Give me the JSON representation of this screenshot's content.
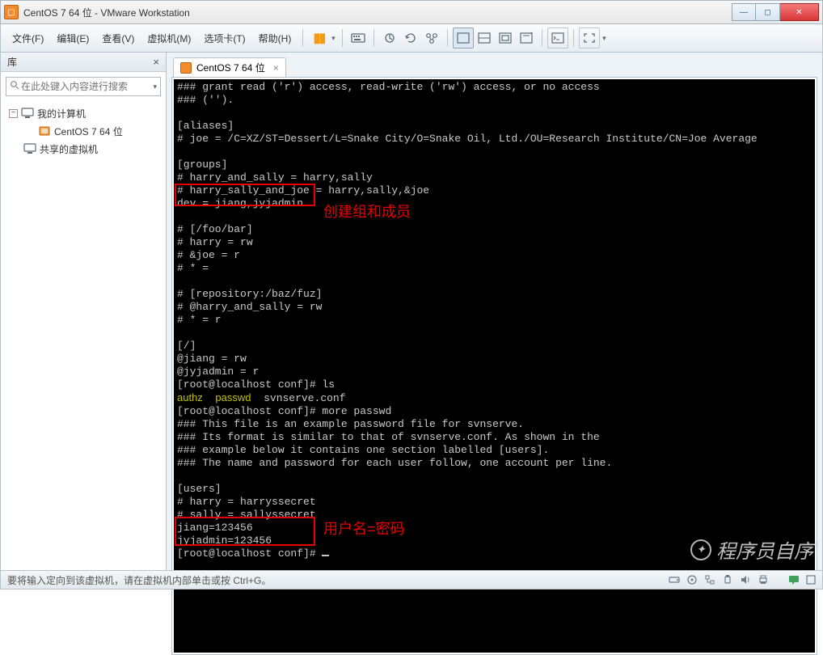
{
  "window": {
    "title": "CentOS 7 64 位 - VMware Workstation"
  },
  "menu": {
    "file": "文件(F)",
    "edit": "编辑(E)",
    "view": "查看(V)",
    "vm": "虚拟机(M)",
    "tabs": "选项卡(T)",
    "help": "帮助(H)"
  },
  "sidebar": {
    "title": "库",
    "placeholder": "在此处键入内容进行搜索",
    "root": "我的计算机",
    "vm_name": "CentOS 7 64 位",
    "shared": "共享的虚拟机"
  },
  "tab": {
    "label": "CentOS 7 64 位"
  },
  "terminal_lines": [
    "### grant read ('r') access, read-write ('rw') access, or no access",
    "### ('').",
    "",
    "[aliases]",
    "# joe = /C=XZ/ST=Dessert/L=Snake City/O=Snake Oil, Ltd./OU=Research Institute/CN=Joe Average",
    "",
    "[groups]",
    "# harry_and_sally = harry,sally",
    "# harry_sally_and_joe = harry,sally,&joe",
    "dev = jiang,jyjadmin",
    "",
    "# [/foo/bar]",
    "# harry = rw",
    "# &joe = r",
    "# * =",
    "",
    "# [repository:/baz/fuz]",
    "# @harry_and_sally = rw",
    "# * = r",
    "",
    "[/]",
    "@jiang = rw",
    "@jyjadmin = r",
    "[root@localhost conf]# ls",
    "authz  passwd  svnserve.conf",
    "[root@localhost conf]# more passwd",
    "### This file is an example password file for svnserve.",
    "### Its format is similar to that of svnserve.conf. As shown in the",
    "### example below it contains one section labelled [users].",
    "### The name and password for each user follow, one account per line.",
    "",
    "[users]",
    "# harry = harryssecret",
    "# sally = sallyssecret",
    "jiang=123456",
    "jyjadmin=123456",
    "[root@localhost conf]# "
  ],
  "annotations": {
    "box1_label": "创建组和成员",
    "box2_label": "用户名=密码"
  },
  "statusbar": {
    "hint": "要将输入定向到该虚拟机，请在虚拟机内部单击或按 Ctrl+G。"
  },
  "watermark": {
    "text": "程序员自序"
  }
}
